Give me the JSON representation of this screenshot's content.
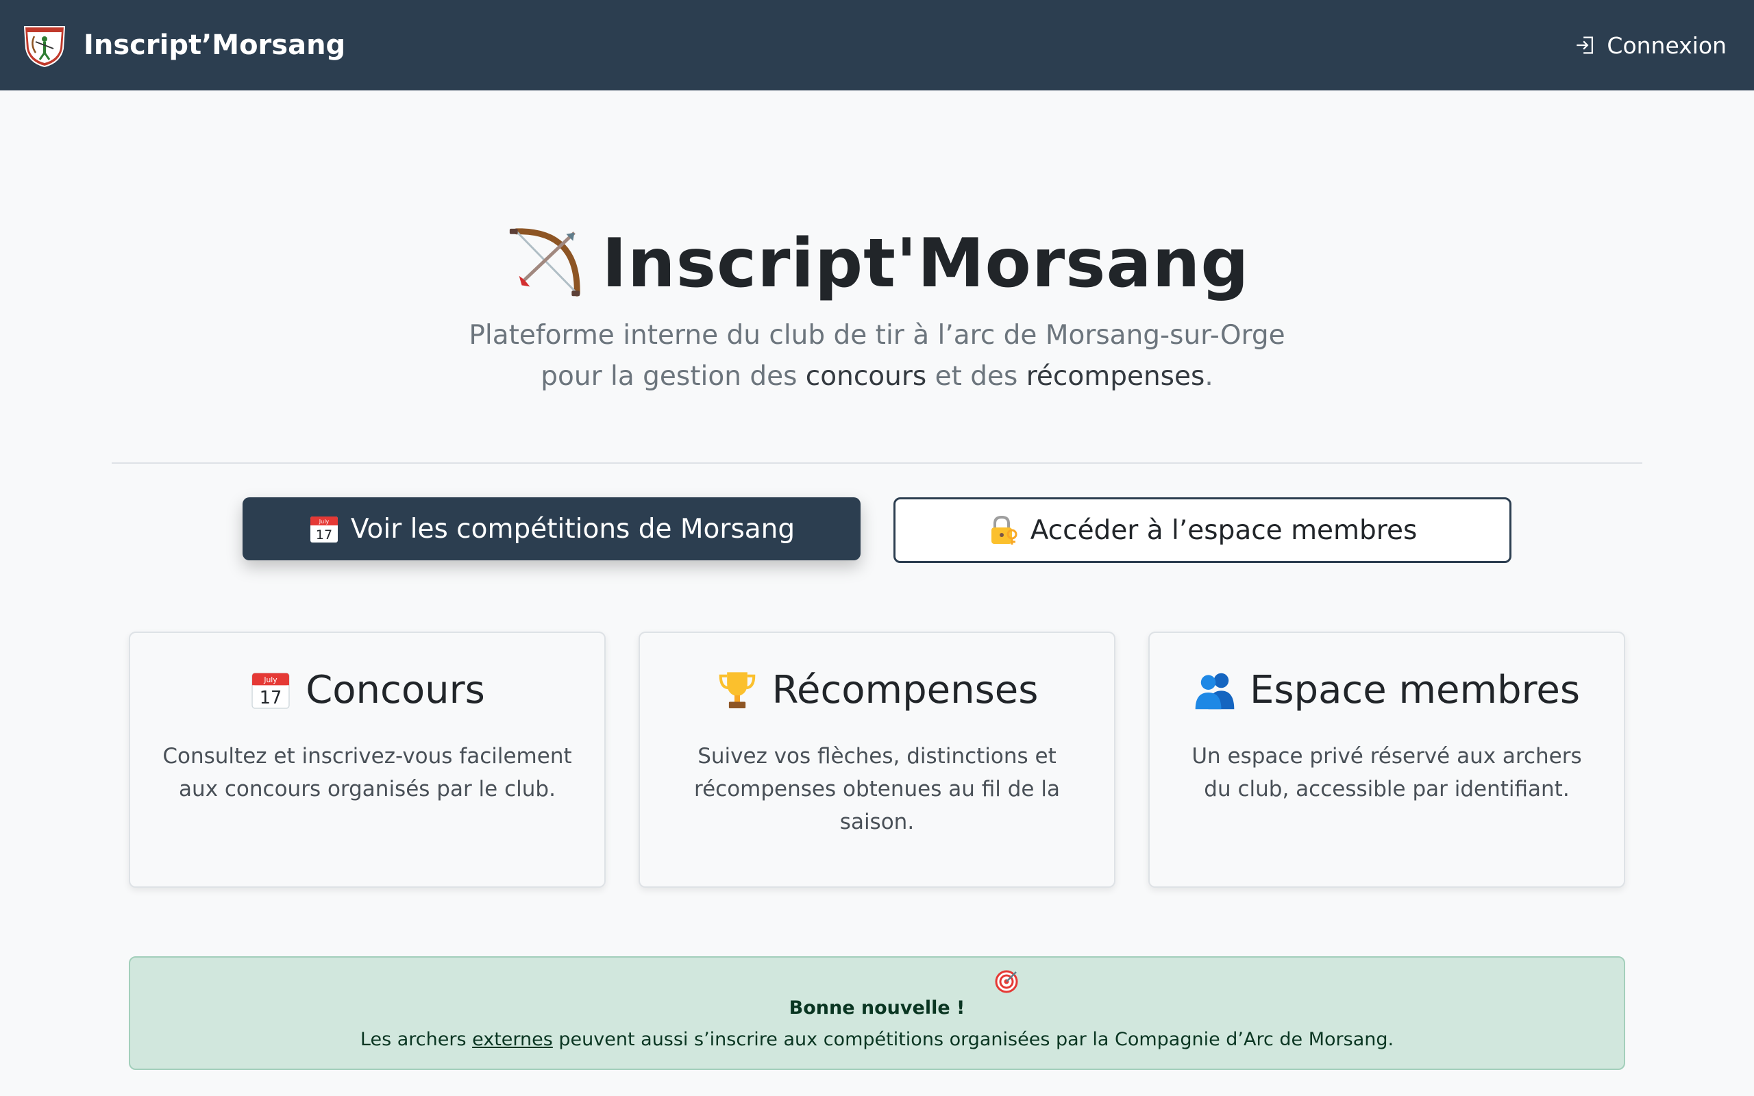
{
  "navbar": {
    "brand": "Inscript’Morsang",
    "login_label": "Connexion",
    "background": "#2c3e50"
  },
  "hero": {
    "title": "Inscript'Morsang",
    "subtitle_line1": "Plateforme interne du club de tir à l’arc de Morsang-sur-Orge",
    "subtitle_line2_pre": "pour la gestion des ",
    "subtitle_line2_strong1": "concours",
    "subtitle_line2_mid": " et des ",
    "subtitle_line2_strong2": "récompenses",
    "subtitle_line2_post": "."
  },
  "buttons": {
    "competitions_label": "Voir les compétitions de Morsang",
    "members_label": "Accéder à l’espace membres"
  },
  "cards": [
    {
      "title": "Concours",
      "text": "Consultez et inscrivez-vous facilement aux concours organisés par le club.",
      "icon": "calendar-icon"
    },
    {
      "title": "Récompenses",
      "text": "Suivez vos flèches, distinctions et récompenses obtenues au fil de la saison.",
      "icon": "trophy-icon"
    },
    {
      "title": "Espace membres",
      "text": "Un espace privé réservé aux archers du club, accessible par identifiant.",
      "icon": "people-icon"
    }
  ],
  "alert": {
    "title": "Bonne nouvelle !",
    "msg_pre": "Les archers ",
    "msg_link": "externes",
    "msg_post": " peuvent aussi s’inscrire aux compétitions organisées par la Compagnie d’Arc de Morsang."
  },
  "calendar_icon_text": {
    "month": "July",
    "day": "17"
  }
}
